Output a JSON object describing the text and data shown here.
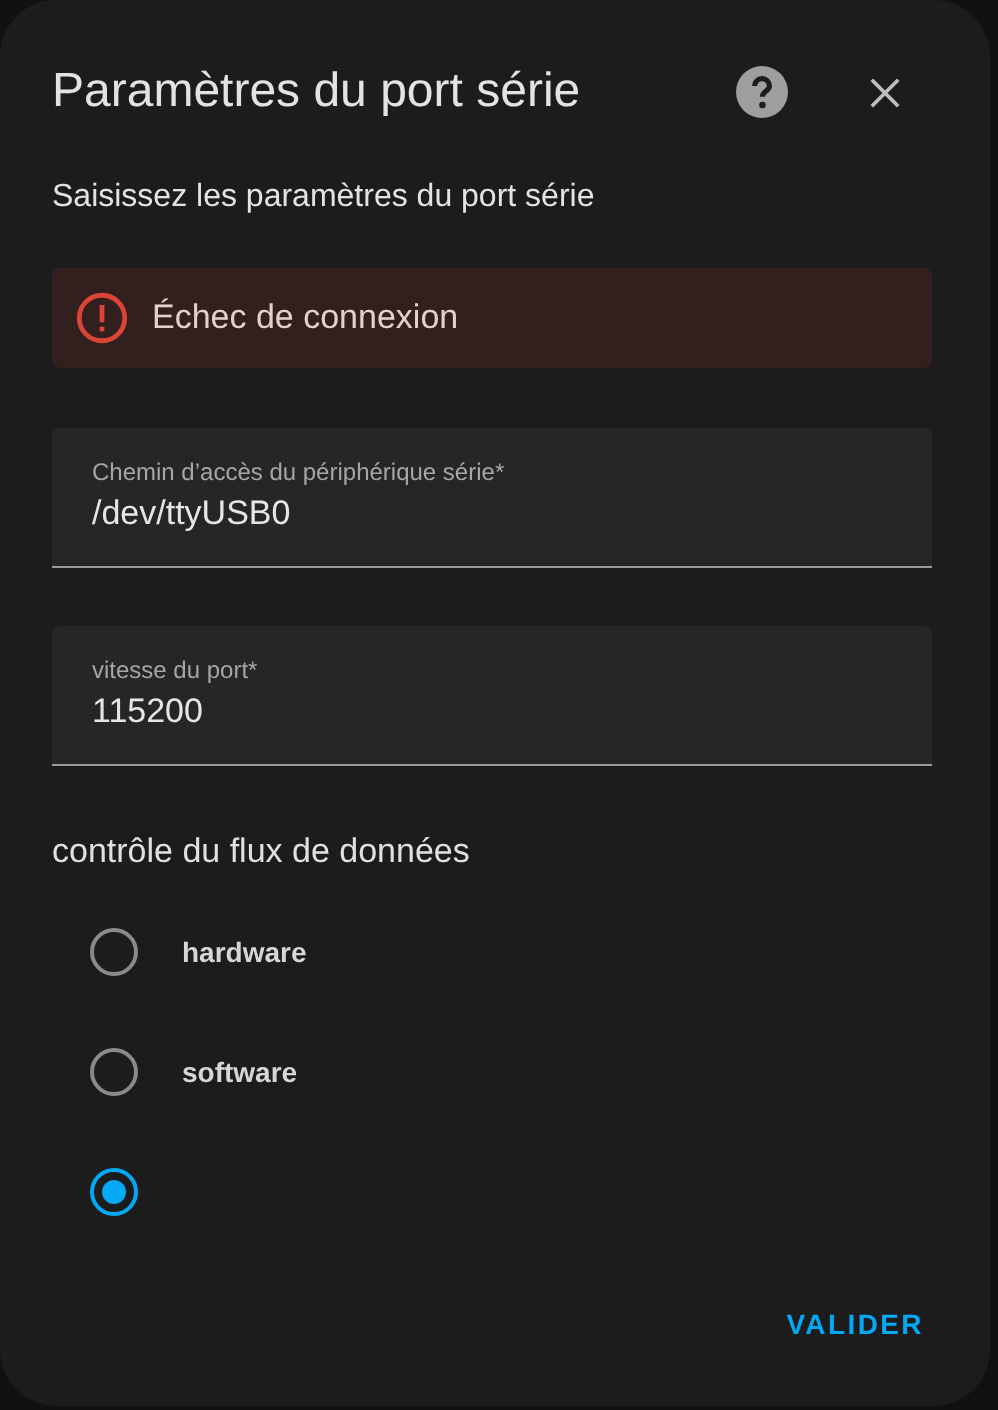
{
  "dialog": {
    "title": "Paramètres du port série",
    "subtitle": "Saisissez les paramètres du port série"
  },
  "error": {
    "message": "Échec de connexion"
  },
  "fields": [
    {
      "label": "Chemin d’accès du périphérique série*",
      "value": "/dev/ttyUSB0"
    },
    {
      "label": "vitesse du port*",
      "value": "115200"
    }
  ],
  "flow_control": {
    "label": "contrôle du flux de données",
    "options": [
      {
        "label": "hardware",
        "selected": false
      },
      {
        "label": "software",
        "selected": false
      },
      {
        "selected": true
      }
    ]
  },
  "buttons": [
    "VALIDER"
  ]
}
